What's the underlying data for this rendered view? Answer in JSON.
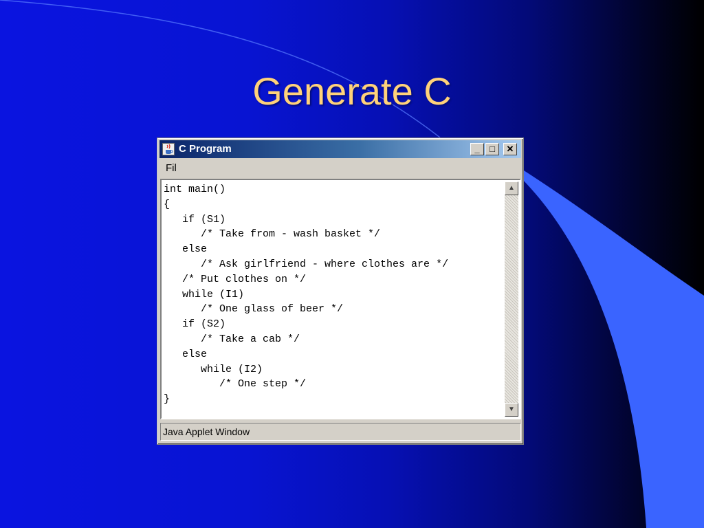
{
  "slide": {
    "title": "Generate C",
    "colors": {
      "title": "#ffd27a",
      "accent_band": "#3a64ff"
    }
  },
  "window": {
    "title": "C Program",
    "icon": "java-coffee-cup-icon",
    "buttons": {
      "minimize": "_",
      "maximize": "□",
      "close": "✕"
    }
  },
  "menu": {
    "file_label": "Fil"
  },
  "editor": {
    "code": "int main()\n{\n   if (S1)\n      /* Take from - wash basket */\n   else\n      /* Ask girlfriend - where clothes are */\n   /* Put clothes on */\n   while (I1)\n      /* One glass of beer */\n   if (S2)\n      /* Take a cab */\n   else\n      while (I2)\n         /* One step */\n}",
    "scroll_up": "▲",
    "scroll_down": "▼"
  },
  "status": {
    "text": "Java Applet Window"
  }
}
